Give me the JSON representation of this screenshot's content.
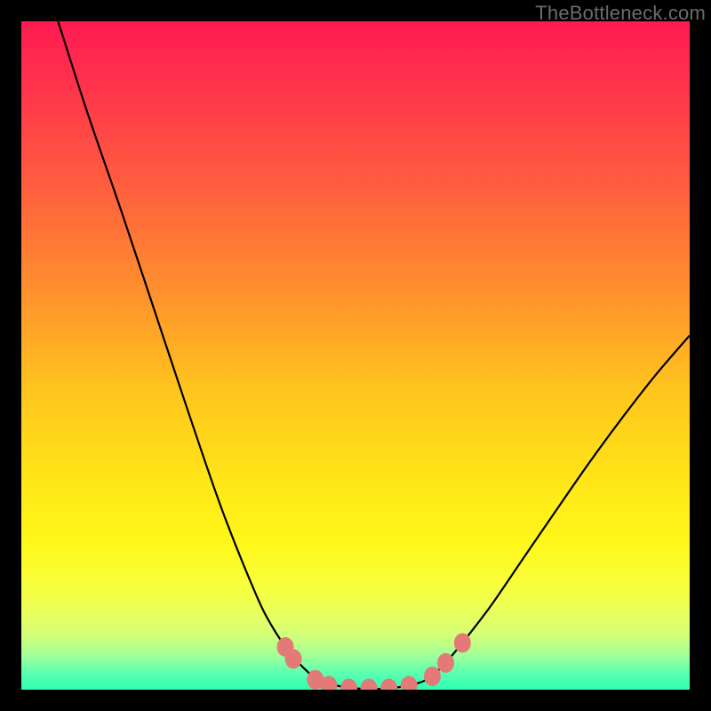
{
  "watermark": "TheBottleneck.com",
  "colors": {
    "frame_bg": "#000000",
    "curve_stroke": "#000000",
    "marker_fill": "#e47a78",
    "gradient_stops": [
      {
        "offset": 0.0,
        "color": "#ff1a52"
      },
      {
        "offset": 0.12,
        "color": "#ff3a4a"
      },
      {
        "offset": 0.25,
        "color": "#ff5f3e"
      },
      {
        "offset": 0.4,
        "color": "#ff8f2e"
      },
      {
        "offset": 0.55,
        "color": "#ffc41e"
      },
      {
        "offset": 0.7,
        "color": "#ffe917"
      },
      {
        "offset": 0.78,
        "color": "#fff71a"
      },
      {
        "offset": 0.84,
        "color": "#f8ff3a"
      },
      {
        "offset": 0.88,
        "color": "#ecff58"
      },
      {
        "offset": 0.92,
        "color": "#d2ff7a"
      },
      {
        "offset": 0.95,
        "color": "#9dff9a"
      },
      {
        "offset": 0.975,
        "color": "#5cffb0"
      },
      {
        "offset": 1.0,
        "color": "#2dffb1"
      }
    ]
  },
  "chart_data": {
    "type": "line",
    "title": "",
    "xlabel": "",
    "ylabel": "",
    "x_range": [
      0,
      1
    ],
    "y_range": [
      0,
      1
    ],
    "series": [
      {
        "name": "bottleneck-curve",
        "x": [
          0.055,
          0.1,
          0.15,
          0.2,
          0.25,
          0.3,
          0.35,
          0.375,
          0.4,
          0.425,
          0.45,
          0.5,
          0.55,
          0.6,
          0.625,
          0.65,
          0.7,
          0.75,
          0.8,
          0.85,
          0.9,
          0.95,
          1.0
        ],
        "y": [
          1.0,
          0.86,
          0.715,
          0.565,
          0.415,
          0.27,
          0.145,
          0.095,
          0.058,
          0.03,
          0.012,
          0.002,
          0.002,
          0.012,
          0.03,
          0.058,
          0.122,
          0.195,
          0.268,
          0.34,
          0.408,
          0.472,
          0.53
        ]
      }
    ],
    "markers": {
      "name": "sweet-spot-markers",
      "points": [
        {
          "x": 0.395,
          "y": 0.064
        },
        {
          "x": 0.407,
          "y": 0.046
        },
        {
          "x": 0.44,
          "y": 0.015
        },
        {
          "x": 0.46,
          "y": 0.006
        },
        {
          "x": 0.49,
          "y": 0.002
        },
        {
          "x": 0.52,
          "y": 0.002
        },
        {
          "x": 0.55,
          "y": 0.002
        },
        {
          "x": 0.58,
          "y": 0.006
        },
        {
          "x": 0.615,
          "y": 0.02
        },
        {
          "x": 0.635,
          "y": 0.04
        },
        {
          "x": 0.66,
          "y": 0.07
        }
      ]
    }
  }
}
